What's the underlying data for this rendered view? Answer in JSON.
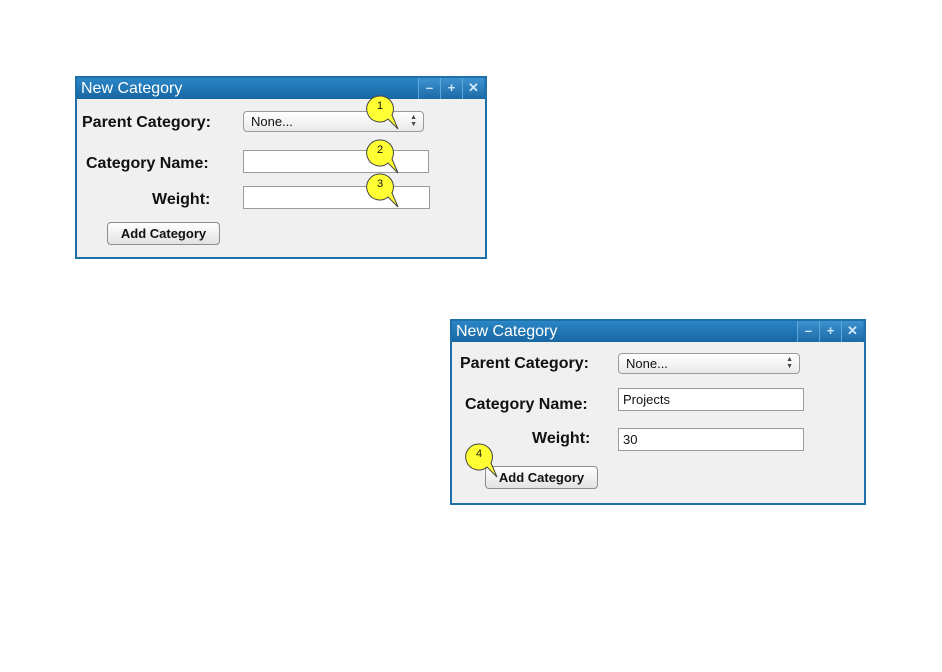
{
  "windows": [
    {
      "title": "New Category",
      "titlebar_buttons": [
        "–",
        "+",
        "✕"
      ],
      "parent_label": "Parent Category:",
      "parent_value": "None...",
      "name_label": "Category Name:",
      "name_value": "",
      "weight_label": "Weight:",
      "weight_value": "",
      "add_button": "Add Category"
    },
    {
      "title": "New Category",
      "titlebar_buttons": [
        "–",
        "+",
        "✕"
      ],
      "parent_label": "Parent Category:",
      "parent_value": "None...",
      "name_label": "Category Name:",
      "name_value": "Projects",
      "weight_label": "Weight:",
      "weight_value": "30",
      "add_button": "Add Category"
    }
  ],
  "callouts": [
    "1",
    "2",
    "3",
    "4"
  ],
  "colors": {
    "titlebar": "#1f6fa8",
    "window_bg": "#f0f0f0",
    "callout": "#ffff33"
  }
}
